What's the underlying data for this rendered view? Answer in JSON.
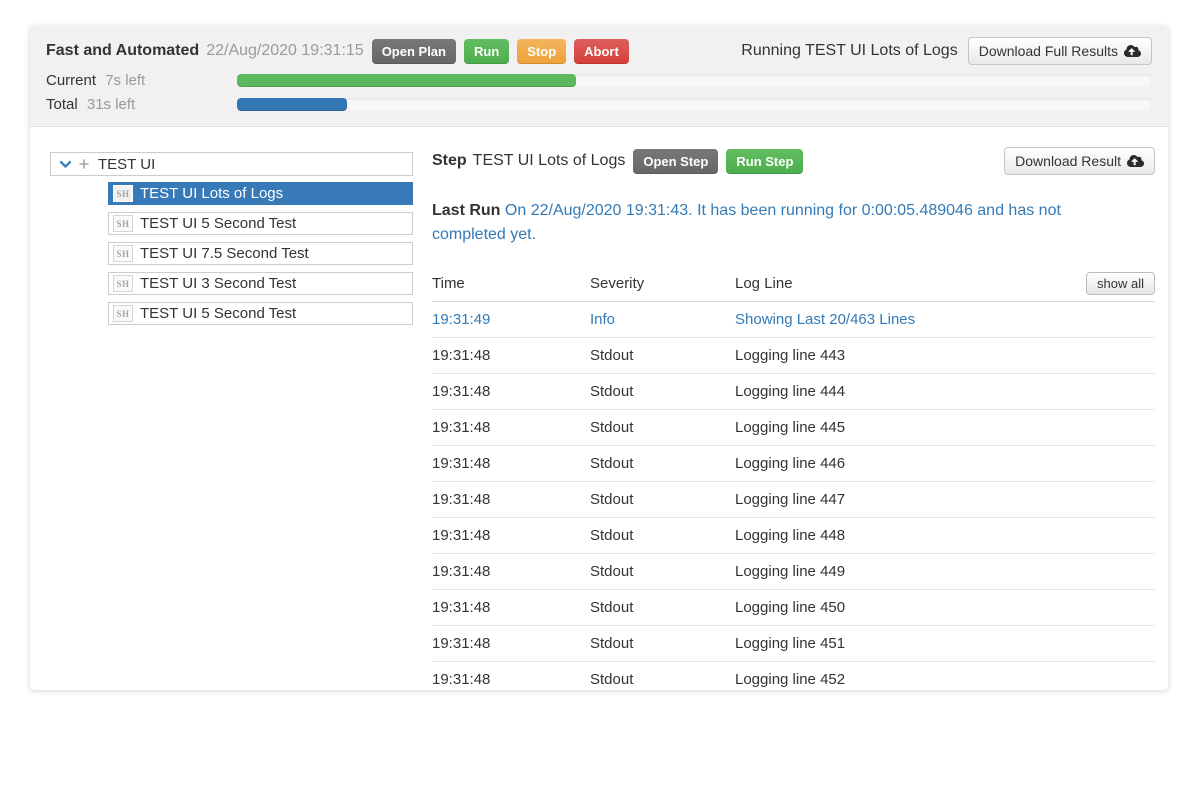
{
  "plan_header": {
    "title": "Fast and Automated",
    "timestamp": "22/Aug/2020 19:31:15",
    "open_plan_label": "Open Plan",
    "run_label": "Run",
    "stop_label": "Stop",
    "abort_label": "Abort",
    "running_status": "Running TEST UI Lots of Logs",
    "download_full_results_label": "Download Full Results",
    "progress": [
      {
        "label": "Current",
        "remaining": "7s left",
        "percent": 37,
        "color": "#5cb85c"
      },
      {
        "label": "Total",
        "remaining": "31s left",
        "percent": 12,
        "color": "#3277b3"
      }
    ]
  },
  "sidebar": {
    "root_label": "TEST UI",
    "items": [
      {
        "badge": "SH",
        "label": "TEST UI Lots of Logs",
        "selected": true
      },
      {
        "badge": "SH",
        "label": "TEST UI 5 Second Test",
        "selected": false
      },
      {
        "badge": "SH",
        "label": "TEST UI 7.5 Second Test",
        "selected": false
      },
      {
        "badge": "SH",
        "label": "TEST UI 3 Second Test",
        "selected": false
      },
      {
        "badge": "SH",
        "label": "TEST UI 5 Second Test",
        "selected": false
      }
    ]
  },
  "step_panel": {
    "step_label": "Step",
    "step_name": "TEST UI Lots of Logs",
    "open_step_label": "Open Step",
    "run_step_label": "Run Step",
    "download_result_label": "Download Result",
    "last_run_label": "Last Run",
    "last_run_text": "On 22/Aug/2020 19:31:43. It has been running for 0:00:05.489046 and has not completed yet."
  },
  "log_table": {
    "columns": [
      "Time",
      "Severity",
      "Log Line"
    ],
    "show_all_label": "show all",
    "rows": [
      {
        "time": "19:31:49",
        "severity": "Info",
        "line": "Showing Last 20/463 Lines",
        "highlight": true
      },
      {
        "time": "19:31:48",
        "severity": "Stdout",
        "line": "Logging line 443",
        "highlight": false
      },
      {
        "time": "19:31:48",
        "severity": "Stdout",
        "line": "Logging line 444",
        "highlight": false
      },
      {
        "time": "19:31:48",
        "severity": "Stdout",
        "line": "Logging line 445",
        "highlight": false
      },
      {
        "time": "19:31:48",
        "severity": "Stdout",
        "line": "Logging line 446",
        "highlight": false
      },
      {
        "time": "19:31:48",
        "severity": "Stdout",
        "line": "Logging line 447",
        "highlight": false
      },
      {
        "time": "19:31:48",
        "severity": "Stdout",
        "line": "Logging line 448",
        "highlight": false
      },
      {
        "time": "19:31:48",
        "severity": "Stdout",
        "line": "Logging line 449",
        "highlight": false
      },
      {
        "time": "19:31:48",
        "severity": "Stdout",
        "line": "Logging line 450",
        "highlight": false
      },
      {
        "time": "19:31:48",
        "severity": "Stdout",
        "line": "Logging line 451",
        "highlight": false
      },
      {
        "time": "19:31:48",
        "severity": "Stdout",
        "line": "Logging line 452",
        "highlight": false
      }
    ]
  },
  "colors": {
    "accent_blue": "#337ab7",
    "selected_tree_item": "#3879b8",
    "button_gray": "#6e6e6e",
    "button_green": "#5cb85c",
    "button_orange": "#f0ad4e",
    "button_red": "#d9534f",
    "progress_green": "#5cb85c",
    "progress_blue": "#3277b3"
  }
}
